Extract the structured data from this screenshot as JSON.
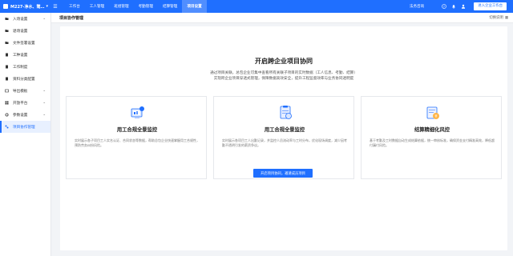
{
  "topbar": {
    "company": "M227-净水、鹭…",
    "nav": [
      "工作台",
      "工人管理",
      "班组管理",
      "考勤管理",
      "结算管理",
      "项目设置"
    ],
    "active_nav": "项目设置",
    "consult": "法务咨询",
    "enter_button": "进入企业工作台"
  },
  "sidebar": {
    "items": [
      {
        "label": "入场设置",
        "icon": "folder-icon",
        "has_arrow": true
      },
      {
        "label": "退场设置",
        "icon": "folder-icon",
        "has_arrow": false
      },
      {
        "label": "文件签署设置",
        "icon": "folder-icon",
        "has_arrow": false
      },
      {
        "label": "工种设置",
        "icon": "doc-icon",
        "has_arrow": false
      },
      {
        "label": "工作制度",
        "icon": "doc-icon",
        "has_arrow": false
      },
      {
        "label": "资料分类配置",
        "icon": "doc-icon",
        "has_arrow": false
      },
      {
        "label": "导出模板",
        "icon": "export-icon",
        "has_arrow": true
      },
      {
        "label": "开放平台",
        "icon": "platform-icon",
        "has_arrow": true
      },
      {
        "label": "参数设置",
        "icon": "gear-icon",
        "has_arrow": true
      },
      {
        "label": "项目协作管理",
        "icon": "collab-icon",
        "has_arrow": false,
        "active": true
      }
    ]
  },
  "header": {
    "page_title": "项目协作管理",
    "collapse_label": "切换说明"
  },
  "main": {
    "title": "开启跨企业项目协同",
    "desc_line1": "通过项目关联，总包企业可集中查看所有关联子项目的实时数据（工人信息、考勤、结算）",
    "desc_line2": "实现跨企业项目穿透式管理，保障数据高效安全，提升工程监督效率与业务协同透明度",
    "cards": [
      {
        "title": "用工合规全景监控",
        "desc": "实时展示各子项目工人实名认证、合同状态等数据，帮助总包企业快速掌握用工合规性，预防劳务纠纷风险。",
        "icon": "monitor-icon"
      },
      {
        "title": "用工合规全景监控",
        "desc": "实时展示各项目工人出勤记录，并监控人员流动率与工时分布，优化现场调度，减少因考勤不透明引发的薪资争议。",
        "icon": "clipboard-icon"
      },
      {
        "title": "结算精细化风控",
        "desc": "基于考勤及工时数据自动生成结算依据，统一审核标准，确保资金支付精准高效，降低超付漏付风险。",
        "icon": "settlement-icon"
      }
    ],
    "primary_button": "开启项目协同，邀请成员项目"
  },
  "colors": {
    "primary": "#1f6fff",
    "sidebar_active_bg": "#e8f0ff",
    "page_bg": "#f2f4f7"
  }
}
